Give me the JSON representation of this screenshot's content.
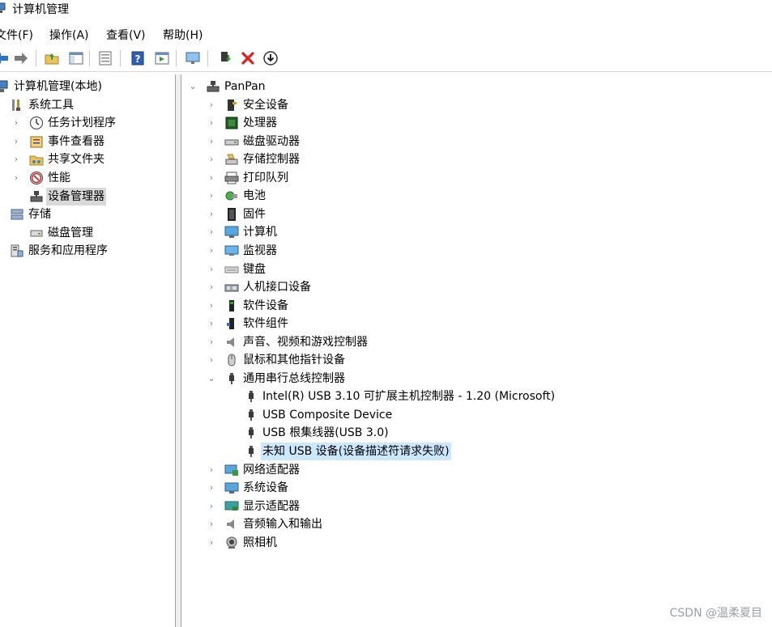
{
  "window": {
    "title": "计算机管理"
  },
  "menu": [
    "文件(F)",
    "操作(A)",
    "查看(V)",
    "帮助(H)"
  ],
  "left_tree": [
    {
      "label": "计算机管理(本地)",
      "icon": "computer-manage-icon",
      "arrow": "",
      "level": 0
    },
    {
      "label": "系统工具",
      "icon": "tools-icon",
      "arrow": "",
      "level": 1
    },
    {
      "label": "任务计划程序",
      "icon": "clock-icon",
      "arrow": "›",
      "level": 2
    },
    {
      "label": "事件查看器",
      "icon": "event-viewer-icon",
      "arrow": "›",
      "level": 2
    },
    {
      "label": "共享文件夹",
      "icon": "shared-folder-icon",
      "arrow": "›",
      "level": 2
    },
    {
      "label": "性能",
      "icon": "performance-icon",
      "arrow": "›",
      "level": 2
    },
    {
      "label": "设备管理器",
      "icon": "device-manager-icon",
      "arrow": "",
      "level": 2,
      "selected": true
    },
    {
      "label": "存储",
      "icon": "storage-icon",
      "arrow": "",
      "level": 1
    },
    {
      "label": "磁盘管理",
      "icon": "disk-icon",
      "arrow": "",
      "level": 2
    },
    {
      "label": "服务和应用程序",
      "icon": "services-icon",
      "arrow": "",
      "level": 1
    }
  ],
  "device_tree": {
    "root": "PanPan",
    "categories": [
      "安全设备",
      "处理器",
      "磁盘驱动器",
      "存储控制器",
      "打印队列",
      "电池",
      "固件",
      "计算机",
      "监视器",
      "键盘",
      "人机接口设备",
      "软件设备",
      "软件组件",
      "声音、视频和游戏控制器",
      "鼠标和其他指针设备",
      "通用串行总线控制器"
    ],
    "usb_children": [
      "Intel(R) USB 3.10 可扩展主机控制器 - 1.20 (Microsoft)",
      "USB Composite Device",
      "USB 根集线器(USB 3.0)",
      "未知 USB 设备(设备描述符请求失败)"
    ],
    "after_categories": [
      "网络适配器",
      "系统设备",
      "显示适配器",
      "音频输入和输出",
      "照相机"
    ]
  },
  "watermark": "CSDN @温柔夏目"
}
